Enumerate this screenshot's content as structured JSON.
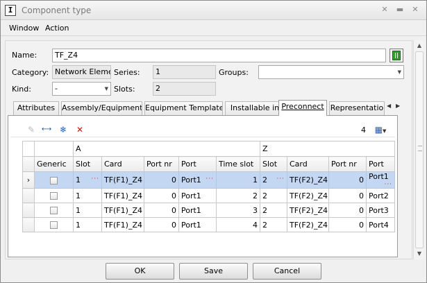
{
  "window": {
    "title": "Component type",
    "icon_glyph": "I"
  },
  "menu": {
    "items": [
      "Window",
      "Action"
    ]
  },
  "form": {
    "name_label": "Name:",
    "name_value": "TF_Z4",
    "category_label": "Category:",
    "category_value": "Network Element",
    "series_label": "Series:",
    "series_value": "1",
    "groups_label": "Groups:",
    "groups_value": "",
    "kind_label": "Kind:",
    "kind_value": "-",
    "slots_label": "Slots:",
    "slots_value": "2"
  },
  "tabs": [
    {
      "label": "Attributes",
      "active": false
    },
    {
      "label": "Assembly/Equipment",
      "active": false
    },
    {
      "label": "Equipment Template",
      "active": false
    },
    {
      "label": "Installable in",
      "active": false
    },
    {
      "label": "Preconnect",
      "active": true
    },
    {
      "label": "Representatio",
      "active": false
    }
  ],
  "toolbar": {
    "count": "4"
  },
  "grid": {
    "band_a": "A",
    "band_z": "Z",
    "columns": [
      "Generic",
      "Slot",
      "Card",
      "Port nr",
      "Port",
      "Time slot",
      "Slot",
      "Card",
      "Port nr",
      "Port"
    ],
    "rows": [
      {
        "selected": true,
        "generic": false,
        "a_slot": "1",
        "a_card": "TF(F1)_Z4",
        "a_port_nr": "0",
        "a_port": "Port1",
        "time_slot": "1",
        "z_slot": "2",
        "z_card": "TF(F2)_Z4",
        "z_port_nr": "0",
        "z_port": "Port1"
      },
      {
        "selected": false,
        "generic": false,
        "a_slot": "1",
        "a_card": "TF(F1)_Z4",
        "a_port_nr": "0",
        "a_port": "Port1",
        "time_slot": "2",
        "z_slot": "2",
        "z_card": "TF(F2)_Z4",
        "z_port_nr": "0",
        "z_port": "Port2"
      },
      {
        "selected": false,
        "generic": false,
        "a_slot": "1",
        "a_card": "TF(F1)_Z4",
        "a_port_nr": "0",
        "a_port": "Port1",
        "time_slot": "3",
        "z_slot": "2",
        "z_card": "TF(F2)_Z4",
        "z_port_nr": "0",
        "z_port": "Port3"
      },
      {
        "selected": false,
        "generic": false,
        "a_slot": "1",
        "a_card": "TF(F1)_Z4",
        "a_port_nr": "0",
        "a_port": "Port1",
        "time_slot": "4",
        "z_slot": "2",
        "z_card": "TF(F2)_Z4",
        "z_port_nr": "0",
        "z_port": "Port4"
      }
    ]
  },
  "buttons": {
    "ok": "OK",
    "save": "Save",
    "cancel": "Cancel"
  },
  "colors": {
    "selected_row": "#c3d7f2",
    "delete_icon": "#d01010",
    "snowflake_icon": "#1f5fbf"
  }
}
